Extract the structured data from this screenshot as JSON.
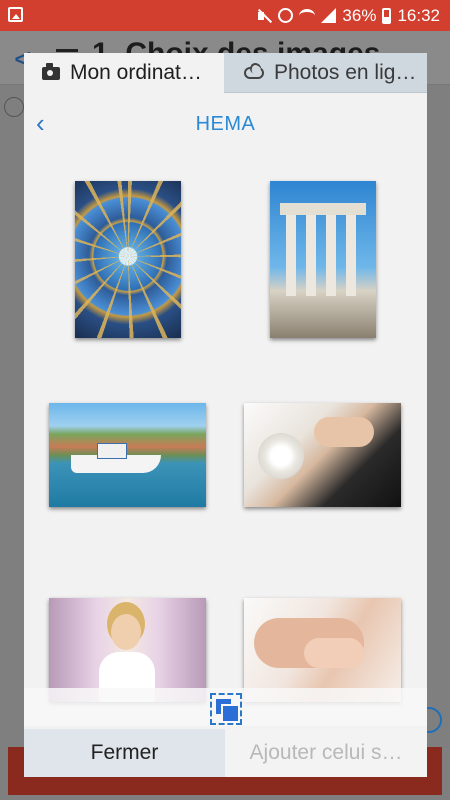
{
  "status_bar": {
    "battery": "36%",
    "time": "16:32",
    "icons": [
      "gallery-icon",
      "mute-icon",
      "alarm-icon",
      "wifi-icon",
      "signal-icon",
      "battery-icon"
    ],
    "color": "#d23f2f"
  },
  "background_app": {
    "title": "1. Choix des images"
  },
  "dialog": {
    "tabs": [
      {
        "label": "Mon ordinat…",
        "icon": "camera-icon",
        "active": true
      },
      {
        "label": "Photos en lig…",
        "icon": "cloud-icon",
        "active": false
      }
    ],
    "folder": {
      "title": "HEMA",
      "back_icon": "chevron-left-icon"
    },
    "photos": [
      {
        "name": "dome"
      },
      {
        "name": "ruins"
      },
      {
        "name": "harbor"
      },
      {
        "name": "wedding-rings"
      },
      {
        "name": "bride"
      },
      {
        "name": "hands"
      }
    ],
    "footer": {
      "close_label": "Fermer",
      "add_label": "Ajouter celui s…"
    },
    "accent_color": "#2b8ad6"
  }
}
